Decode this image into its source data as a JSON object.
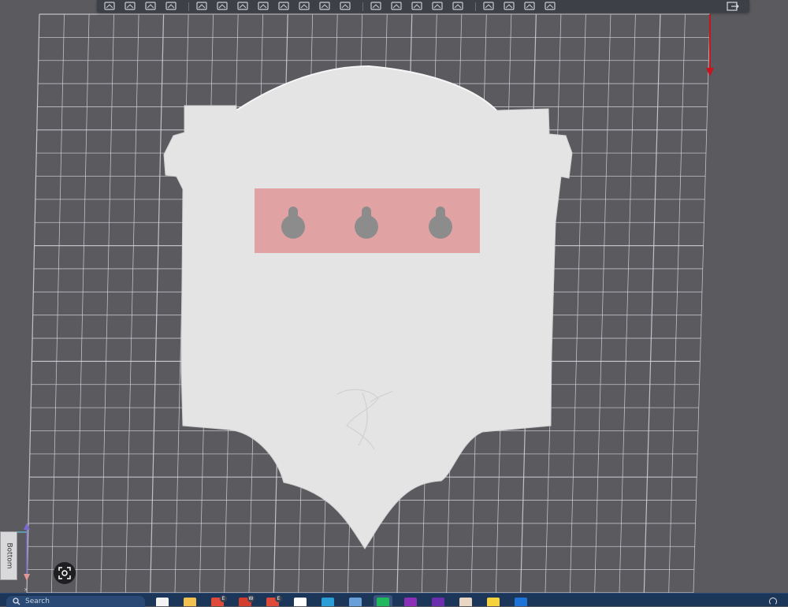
{
  "viewport": {
    "background_color": "#5a5a5f",
    "grid_color": "#d2d4d8",
    "model_color": "#e4e4e4",
    "highlight_color": "#e0a2a2",
    "keyhole_color": "#8c8c8c",
    "axis_colors": {
      "x": "#c8141e",
      "z": "#7a6ad0",
      "y": "#5fb0cc"
    }
  },
  "toolbar": {
    "icons": [
      "add-object-icon",
      "add-plate-icon",
      "add-shape-icon",
      "arrange-icon",
      "orient-icon",
      "move-icon",
      "rotate-icon",
      "scale-icon",
      "cut-icon",
      "support-icon",
      "seam-icon",
      "paint-icon",
      "text-icon",
      "measure-icon",
      "assembly-icon",
      "split-icon",
      "layer-icon",
      "variable-height-icon",
      "brim-icon",
      "emboss-icon",
      "mesh-icon"
    ],
    "right_icon": "export-icon"
  },
  "view_control": {
    "label": "Bottom",
    "capture_icon": "screenshot-icon"
  },
  "taskbar": {
    "search_placeholder": "Search",
    "pinned": [
      {
        "name": "file-explorer-icon",
        "color": "#f4f4f4"
      },
      {
        "name": "folder-icon",
        "color": "#f2c14e"
      },
      {
        "name": "chrome-profile-1-icon",
        "color": "#e04a3a",
        "badge": "E"
      },
      {
        "name": "chrome-profile-2-icon",
        "color": "#d43d2d",
        "badge": "W"
      },
      {
        "name": "chrome-profile-3-icon",
        "color": "#e04a3a",
        "badge": "E"
      },
      {
        "name": "app-red-icon",
        "color": "#ffffff"
      },
      {
        "name": "monitor-icon",
        "color": "#2b9ed8"
      },
      {
        "name": "calculator-icon",
        "color": "#6aa0d8"
      },
      {
        "name": "bambu-studio-icon",
        "color": "#1fb85c",
        "active": true
      },
      {
        "name": "onenote-icon",
        "color": "#8b2fb8"
      },
      {
        "name": "app-purple-icon",
        "color": "#6b2fae"
      },
      {
        "name": "paint-icon",
        "color": "#e9d7c4"
      },
      {
        "name": "sticky-notes-icon",
        "color": "#f6d23c"
      },
      {
        "name": "app-blue-icon",
        "color": "#1e73d8"
      }
    ]
  }
}
